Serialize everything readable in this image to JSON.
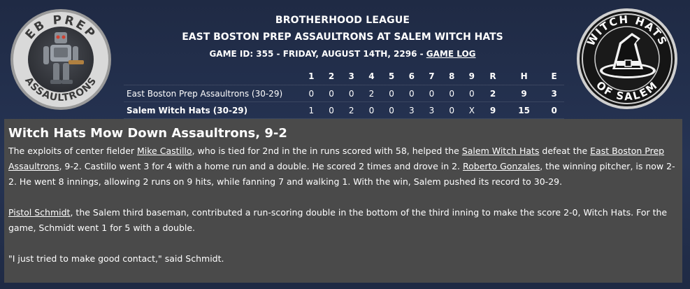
{
  "header": {
    "league": "BROTHERHOOD LEAGUE",
    "matchup": "EAST BOSTON PREP ASSAULTRONS AT SALEM WITCH HATS",
    "game_info": "GAME ID: 355 - FRIDAY, AUGUST 14TH, 2296 - ",
    "game_log_link": "GAME LOG"
  },
  "logos": {
    "away": {
      "icon": "robot-icon",
      "text_top": "EB PREP",
      "text_bottom": "ASSAULTRONS"
    },
    "home": {
      "icon": "witch-hat-icon",
      "text_top": "WITCH HATS",
      "text_bottom": "OF SALEM"
    }
  },
  "linescore": {
    "columns": [
      "1",
      "2",
      "3",
      "4",
      "5",
      "6",
      "7",
      "8",
      "9",
      "R",
      "H",
      "E"
    ],
    "away": {
      "team": "East Boston Prep Assaultrons (30-29)",
      "cells": [
        "0",
        "0",
        "0",
        "2",
        "0",
        "0",
        "0",
        "0",
        "0",
        "2",
        "9",
        "3"
      ]
    },
    "home": {
      "team": "Salem Witch Hats (30-29)",
      "cells": [
        "1",
        "0",
        "2",
        "0",
        "0",
        "3",
        "3",
        "0",
        "X",
        "9",
        "15",
        "0"
      ]
    }
  },
  "story": {
    "headline": "Witch Hats Mow Down Assaultrons, 9-2",
    "p1": {
      "t1": "The exploits of center fielder ",
      "l1": "Mike Castillo",
      "t2": ", who is tied for 2nd in the in runs scored with 58, helped the ",
      "l2": "Salem Witch Hats",
      "t3": " defeat the ",
      "l3": "East Boston Prep Assaultrons",
      "t4": ", 9-2. Castillo went 3 for 4 with a home run and a double. He scored 2 times and drove in 2. ",
      "l4": "Roberto Gonzales",
      "t5": ", the winning pitcher, is now 2-2. He went 8 innings, allowing 2 runs on 9 hits, while fanning 7 and walking 1. With the win, Salem pushed its record to 30-29."
    },
    "p2": {
      "l1": "Pistol Schmidt",
      "t1": ", the Salem third baseman, contributed a run-scoring double in the bottom of the third inning to make the score 2-0, Witch Hats. For the game, Schmidt went 1 for 5 with a double."
    },
    "p3": "\"I just tried to make good contact,\" said Schmidt."
  },
  "colors": {
    "background": "#1f2a44",
    "story_panel": "#4a4a4a",
    "text": "#ffffff"
  }
}
